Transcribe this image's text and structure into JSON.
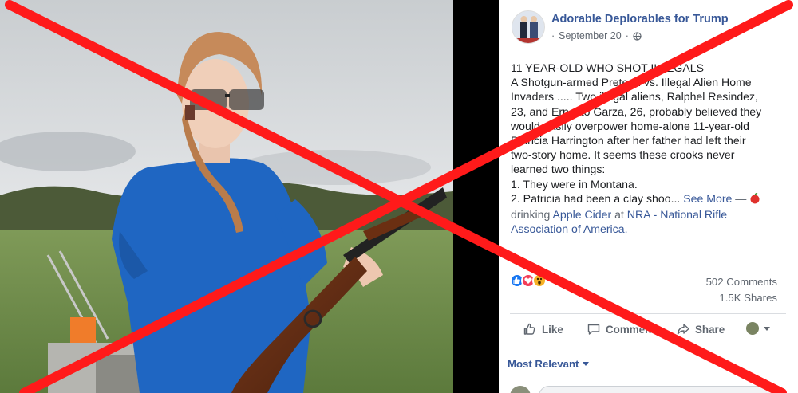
{
  "post": {
    "page_name": "Adorable Deplorables for Trump",
    "date": "September 20",
    "separator": "·",
    "body_lines": [
      "11 YEAR-OLD WHO SHOT ILLEGALS",
      "A Shotgun-armed Preteen vs. Illegal Alien Home",
      "Invaders ..... Two illegal aliens, Ralphel Resindez,",
      "23, and Ernesto Garza, 26, probably believed they",
      "would easily overpower home-alone 11-year-old",
      "Patricia Harrington after her father had left their",
      "two-story home. It seems these crooks never",
      "learned two things:",
      "1. They were in Montana."
    ],
    "last_line_prefix": "2. Patricia had been a clay shoo...",
    "see_more": "See More",
    "dash": "—",
    "activity_verb": "drinking",
    "activity_object": "Apple Cider",
    "at_word": "at",
    "location": "NRA - National Rifle",
    "location_cont": "Association of America."
  },
  "stats": {
    "comments": "502 Comments",
    "shares": "1.5K Shares",
    "reactions": [
      "like",
      "love",
      "wow"
    ]
  },
  "actions": {
    "like": "Like",
    "comment": "Comment",
    "share": "Share"
  },
  "comments_filter": {
    "label": "Most Relevant"
  },
  "icons": {
    "globe": "globe-icon",
    "like": "thumbs-up-icon",
    "comment": "speech-bubble-icon",
    "share": "share-arrow-icon",
    "apple": "apple-icon"
  },
  "colors": {
    "cross": "#ff0000",
    "link": "#385898",
    "muted": "#606770"
  }
}
